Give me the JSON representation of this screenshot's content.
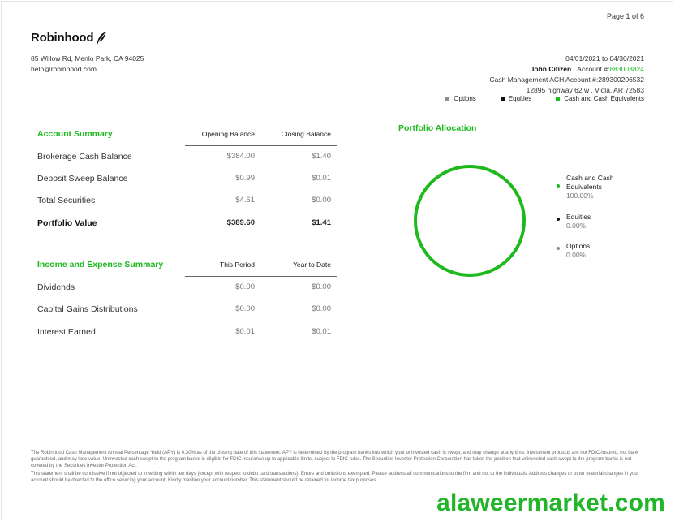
{
  "page": {
    "number": "Page 1 of 6"
  },
  "brand": {
    "name": "Robinhood",
    "address": "85 Willow Rd, Menlo Park, CA 94025",
    "email": "help@robinhood.com"
  },
  "statement": {
    "period": "04/01/2021 to 04/30/2021",
    "customer_name": "John Citizen",
    "account_label": "Account #:",
    "account_number": "883003824",
    "cma_label": "Cash Management ACH Account #:",
    "cma_number": "289300206532",
    "customer_address": "12895 highway 62 w , Viola, AR 72583"
  },
  "legend": [
    {
      "label": "Options",
      "color": "#8c8c8c"
    },
    {
      "label": "Equities",
      "color": "#111111"
    },
    {
      "label": "Cash and Cash Equivalents",
      "color": "#1db91d"
    }
  ],
  "account_summary": {
    "title": "Account Summary",
    "col1": "Opening Balance",
    "col2": "Closing Balance",
    "rows": [
      {
        "label": "Brokerage Cash Balance",
        "v1": "$384.00",
        "v2": "$1.40"
      },
      {
        "label": "Deposit Sweep Balance",
        "v1": "$0.99",
        "v2": "$0.01"
      },
      {
        "label": "Total Securities",
        "v1": "$4.61",
        "v2": "$0.00"
      },
      {
        "label": "Portfolio Value",
        "v1": "$389.60",
        "v2": "$1.41"
      }
    ]
  },
  "income_summary": {
    "title": "Income and Expense Summary",
    "col1": "This Period",
    "col2": "Year to Date",
    "rows": [
      {
        "label": "Dividends",
        "v1": "$0.00",
        "v2": "$0.00"
      },
      {
        "label": "Capital Gains Distributions",
        "v1": "$0.00",
        "v2": "$0.00"
      },
      {
        "label": "Interest Earned",
        "v1": "$0.01",
        "v2": "$0.01"
      }
    ]
  },
  "portfolio_allocation": {
    "title": "Portfolio Allocation",
    "items": [
      {
        "label_line1": "Cash and Cash",
        "label_line2": "Equivalents",
        "percent": "100.00%",
        "color": "#1db91d"
      },
      {
        "label_line1": "Equities",
        "label_line2": "",
        "percent": "0.00%",
        "color": "#111111"
      },
      {
        "label_line1": "Options",
        "label_line2": "",
        "percent": "0.00%",
        "color": "#8c8c8c"
      }
    ]
  },
  "footer": {
    "p1": "The Robinhood Cash Management Annual Percentage Yield (APY) is 0.30% as of the closing date of this statement. APY is determined by the program banks into which your uninvested cash is swept, and may change at any time. Investment products are not FDIC-insured, not bank guaranteed, and may lose value. Uninvested cash swept to the program banks is eligible for FDIC insurance up to applicable limits, subject to FDIC rules. The Securities Investor Protection Corporation has taken the position that uninvested cash swept to the program banks is not covered by the Securities Investor Protection Act.",
    "p2": "This statement shall be conclusive if not objected to in writing within ten days (except with respect to debit card transactions). Errors and omissions exempted. Please address all communications to the firm and not to the individuals. Address changes or other material changes in your account should be directed to the office servicing your account. Kindly mention your account number. This statement should be retained for income tax purposes."
  },
  "watermark": "alaweermarket.com"
}
